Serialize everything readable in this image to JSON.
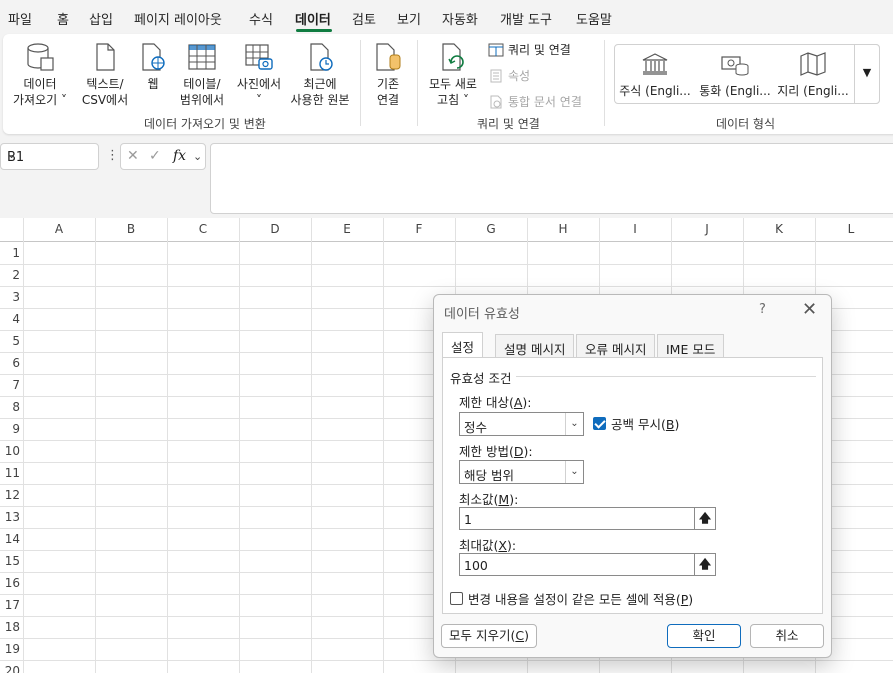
{
  "menu": {
    "tabs": [
      "파일",
      "홈",
      "삽입",
      "페이지 레이아웃",
      "수식",
      "데이터",
      "검토",
      "보기",
      "자동화",
      "개발 도구",
      "도움말"
    ],
    "active": "데이터"
  },
  "ribbon": {
    "get_data": {
      "line1": "데이터",
      "line2": "가져오기 ˅"
    },
    "text_csv": {
      "line1": "텍스트/",
      "line2": "CSV에서"
    },
    "web": {
      "line1": "웹"
    },
    "table_range": {
      "line1": "테이블/",
      "line2": "범위에서"
    },
    "from_picture": {
      "line1": "사진에서",
      "line2": "˅"
    },
    "recent_sources": {
      "line1": "최근에",
      "line2": "사용한 원본"
    },
    "existing_conn": {
      "line1": "기존",
      "line2": "연결"
    },
    "group1_label": "데이터 가져오기 및 변환",
    "refresh_all": {
      "line1": "모두 새로",
      "line2": "고침 ˅"
    },
    "queries_connections": "쿼리 및 연결",
    "properties": "속성",
    "edit_links": "통합 문서 연결",
    "group2_label": "쿼리 및 연결",
    "data_types": {
      "stocks": "주식 (Engli...",
      "currency": "통화 (Engli...",
      "geography": "지리 (Engli..."
    },
    "group3_label": "데이터 형식"
  },
  "formula_bar": {
    "name_box": "B1",
    "fx": "fx",
    "formula": ""
  },
  "grid": {
    "columns": [
      "A",
      "B",
      "C",
      "D",
      "E",
      "F",
      "G",
      "H",
      "I",
      "J",
      "K",
      "L"
    ],
    "rows": [
      "1",
      "2",
      "3",
      "4",
      "5",
      "6",
      "7",
      "8",
      "9",
      "10",
      "11",
      "12",
      "13",
      "14",
      "15",
      "16",
      "17",
      "18",
      "19",
      "20"
    ]
  },
  "dialog": {
    "title": "데이터 유효성",
    "help": "?",
    "tabs": [
      "설정",
      "설명 메시지",
      "오류 메시지",
      "IME 모드"
    ],
    "active_tab": "설정",
    "criteria_label": "유효성 조건",
    "allow_label": "제한 대상(",
    "allow_key": "A",
    "allow_value": "정수",
    "ignore_blank_label": "공백 무시(",
    "ignore_blank_key": "B",
    "ignore_blank_checked": true,
    "data_label": "제한 방법(",
    "data_key": "D",
    "data_value": "해당 범위",
    "min_label": "최소값(",
    "min_key": "M",
    "min_value": "1",
    "max_label": "최대값(",
    "max_key": "X",
    "max_value": "100",
    "apply_all_label": "변경 내용을 설정이 같은 모든 셀에 적용(",
    "apply_all_key": "P",
    "apply_all_checked": false,
    "clear_all": "모두 지우기(",
    "clear_all_key": "C",
    "ok": "확인",
    "cancel": "취소"
  }
}
